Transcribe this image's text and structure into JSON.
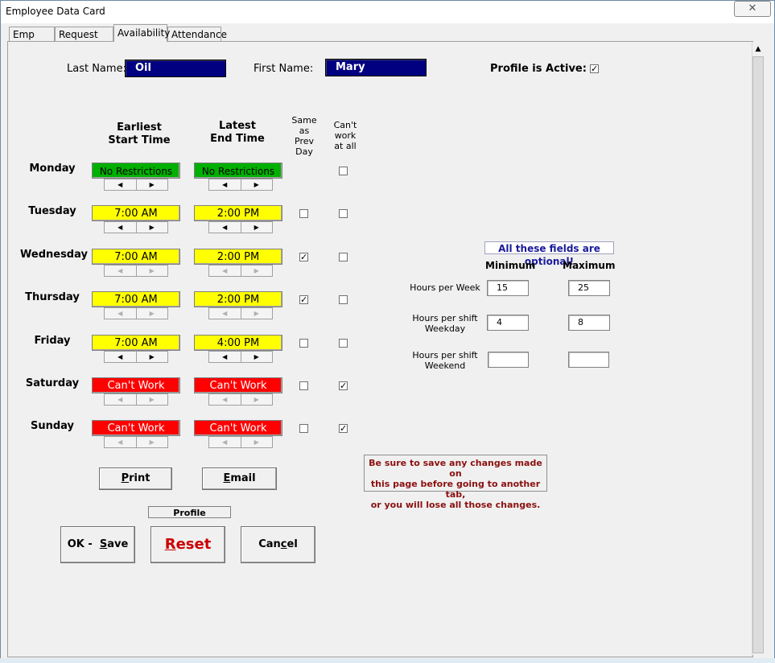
{
  "window": {
    "title": "Employee Data Card",
    "close_glyph": "✕"
  },
  "tabs": [
    {
      "label": "Emp Data"
    },
    {
      "label": "Request Off"
    },
    {
      "label": "Availability"
    },
    {
      "label": "Attendance"
    }
  ],
  "header": {
    "last_name_label": "Last Name:",
    "last_name_value": "Oil",
    "first_name_label": "First Name:",
    "first_name_value": "Mary",
    "active_label": "Profile is Active:",
    "active_checked": true
  },
  "columns": {
    "earliest_line1": "Earliest",
    "earliest_line2": "Start Time",
    "latest_line1": "Latest",
    "latest_line2": "End Time",
    "same_l1": "Same",
    "same_l2": "as",
    "same_l3": "Prev",
    "same_l4": "Day",
    "cant_l1": "Can't",
    "cant_l2": "work",
    "cant_l3": "at all"
  },
  "days": [
    {
      "name": "Monday",
      "start": "No Restrictions",
      "end": "No Restrictions",
      "status": "green",
      "same": null,
      "cant": false
    },
    {
      "name": "Tuesday",
      "start": "7:00 AM",
      "end": "2:00 PM",
      "status": "yellow",
      "same": false,
      "cant": false
    },
    {
      "name": "Wednesday",
      "start": "7:00 AM",
      "end": "2:00 PM",
      "status": "yellow",
      "same": true,
      "cant": false
    },
    {
      "name": "Thursday",
      "start": "7:00 AM",
      "end": "2:00 PM",
      "status": "yellow",
      "same": true,
      "cant": false
    },
    {
      "name": "Friday",
      "start": "7:00 AM",
      "end": "4:00 PM",
      "status": "yellow",
      "same": false,
      "cant": false
    },
    {
      "name": "Saturday",
      "start": "Can't Work",
      "end": "Can't Work",
      "status": "red",
      "same": false,
      "cant": true
    },
    {
      "name": "Sunday",
      "start": "Can't Work",
      "end": "Can't Work",
      "status": "red",
      "same": false,
      "cant": true
    }
  ],
  "optional": {
    "banner": "All these fields are optional!",
    "min_label": "Minimum",
    "max_label": "Maximum",
    "week_label": "Hours per Week",
    "week_min": "15",
    "week_max": "25",
    "weekday_l1": "Hours per shift",
    "weekday_l2": "Weekday",
    "weekday_min": "4",
    "weekday_max": "8",
    "weekend_l1": "Hours per shift",
    "weekend_l2": "Weekend",
    "weekend_min": "",
    "weekend_max": ""
  },
  "buttons": {
    "print_u": "P",
    "print_rest": "rint",
    "email_u": "E",
    "email_rest": "mail",
    "ok_pre": "OK -  ",
    "ok_u": "S",
    "ok_rest": "ave",
    "reset_u": "R",
    "reset_rest": "eset",
    "cancel_pre": "Can",
    "cancel_u": "c",
    "cancel_rest": "el",
    "profile": "Profile"
  },
  "warning": {
    "line1": "Be sure to save any changes made on",
    "line2": "this page before going to another tab,",
    "line3": "or you will lose all those changes."
  },
  "colors": {
    "green": "#00b000",
    "yellow": "#ffff00",
    "red": "#ff0000",
    "navy": "#000080",
    "warning": "#8b1010"
  }
}
